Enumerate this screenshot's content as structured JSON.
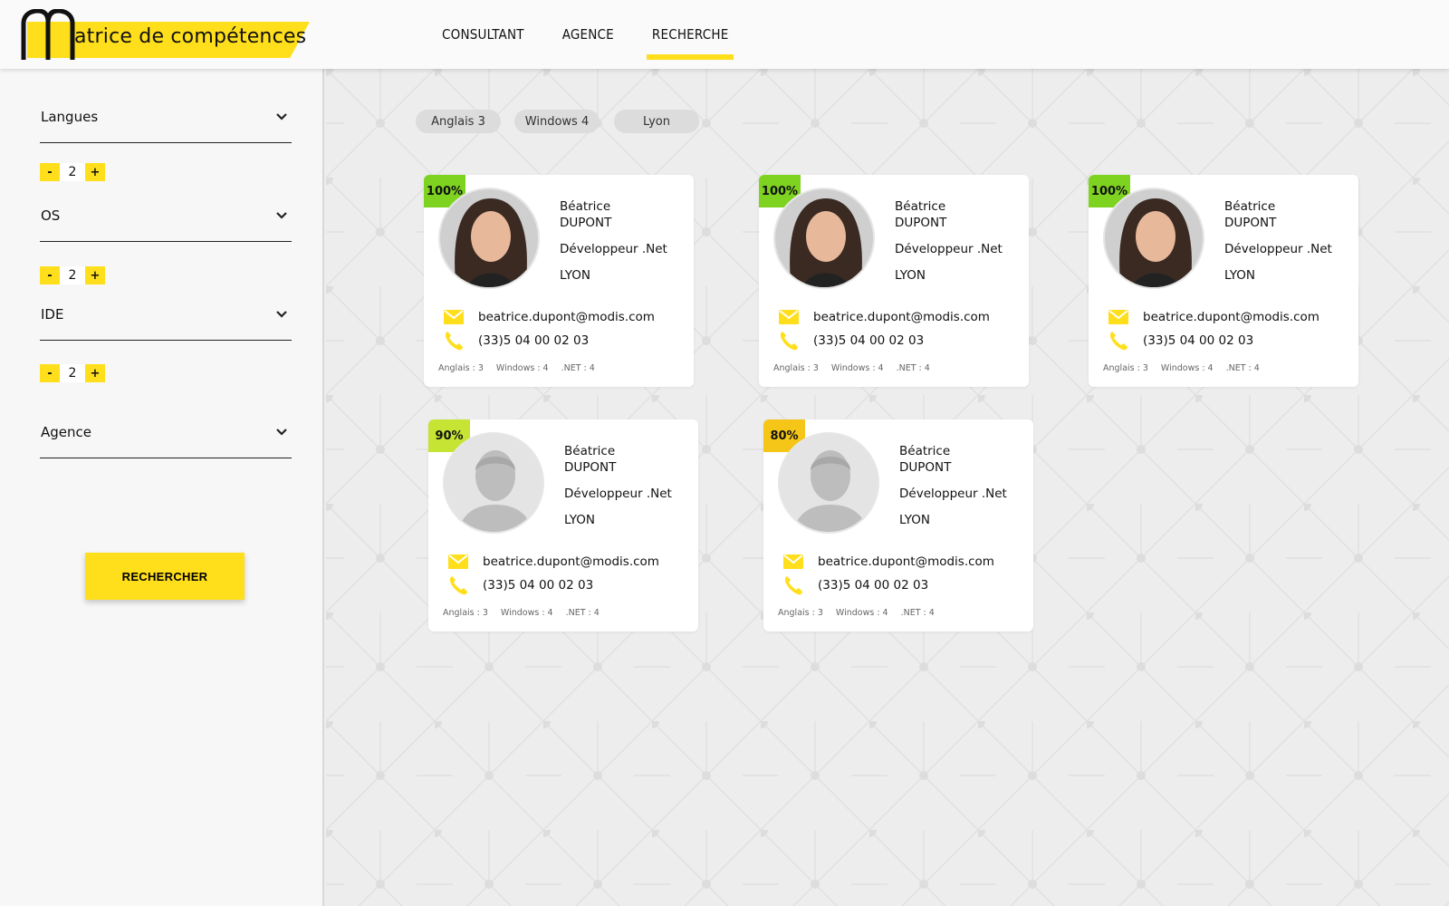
{
  "app": {
    "logo_text": "atrice de compétences"
  },
  "nav": [
    {
      "label": "CONSULTANT",
      "active": false
    },
    {
      "label": "AGENCE",
      "active": false
    },
    {
      "label": "RECHERCHE",
      "active": true
    }
  ],
  "sidebar": {
    "filters": [
      {
        "label": "Langues",
        "value": "2"
      },
      {
        "label": "OS",
        "value": "2"
      },
      {
        "label": "IDE",
        "value": "2"
      },
      {
        "label": "Agence"
      }
    ],
    "minus_label": "-",
    "plus_label": "+",
    "search_button": "RECHERCHER"
  },
  "chips": [
    "Anglais 3",
    "Windows 4",
    "Lyon"
  ],
  "cards": [
    {
      "match": "100%",
      "first_name": "Béatrice",
      "last_name": "DUPONT",
      "job": "Développeur .Net",
      "city": "LYON",
      "email": "beatrice.dupont@modis.com",
      "phone": "(33)5 04 00 02 03",
      "skills": [
        "Anglais : 3",
        "Windows : 4",
        ".NET : 4"
      ],
      "badge_color": "#7ed321",
      "photo": "person-photo"
    },
    {
      "match": "100%",
      "first_name": "Béatrice",
      "last_name": "DUPONT",
      "job": "Développeur .Net",
      "city": "LYON",
      "email": "beatrice.dupont@modis.com",
      "phone": "(33)5 04 00 02 03",
      "skills": [
        "Anglais : 3",
        "Windows : 4",
        ".NET : 4"
      ],
      "badge_color": "#7ed321",
      "photo": "person-photo"
    },
    {
      "match": "100%",
      "first_name": "Béatrice",
      "last_name": "DUPONT",
      "job": "Développeur .Net",
      "city": "LYON",
      "email": "beatrice.dupont@modis.com",
      "phone": "(33)5 04 00 02 03",
      "skills": [
        "Anglais : 3",
        "Windows : 4",
        ".NET : 4"
      ],
      "badge_color": "#7ed321",
      "photo": "person-photo"
    },
    {
      "match": "90%",
      "first_name": "Béatrice",
      "last_name": "DUPONT",
      "job": "Développeur .Net",
      "city": "LYON",
      "email": "beatrice.dupont@modis.com",
      "phone": "(33)5 04 00 02 03",
      "skills": [
        "Anglais : 3",
        "Windows : 4",
        ".NET : 4"
      ],
      "badge_color": "#c6e434",
      "photo": "placeholder-avatar"
    },
    {
      "match": "80%",
      "first_name": "Béatrice",
      "last_name": "DUPONT",
      "job": "Développeur .Net",
      "city": "LYON",
      "email": "beatrice.dupont@modis.com",
      "phone": "(33)5 04 00 02 03",
      "skills": [
        "Anglais : 3",
        "Windows : 4",
        ".NET : 4"
      ],
      "badge_color": "#f5c518",
      "photo": "placeholder-avatar"
    }
  ],
  "colors": {
    "accent": "#ffdf1c",
    "match_high": "#7ed321"
  }
}
